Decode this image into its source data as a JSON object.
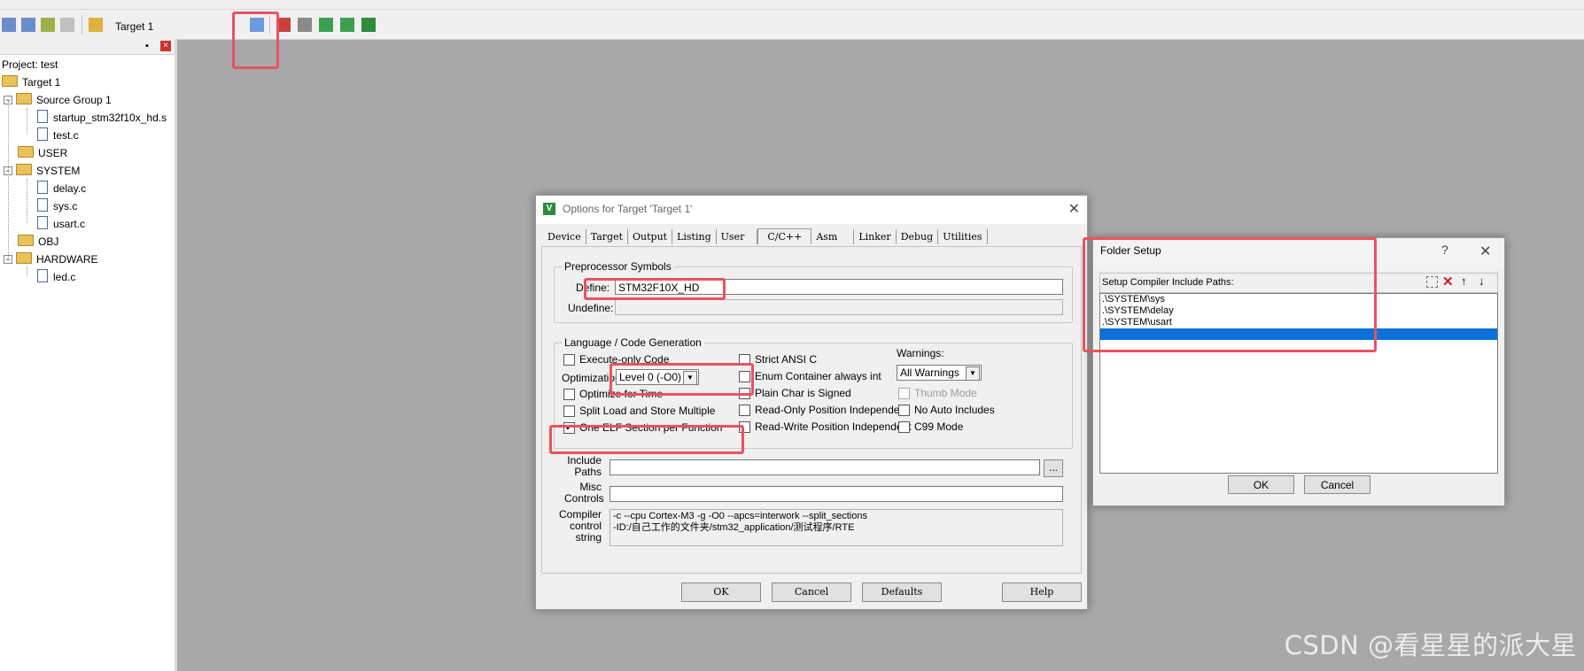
{
  "toolbar": {
    "target_name": "Target 1",
    "icons": [
      "new-file-icon",
      "open-icon",
      "save-icon",
      "cut-icon",
      "copy-icon",
      "paste-icon",
      "undo-icon",
      "redo-icon",
      "bookmark-icon",
      "find-icon",
      "debug-icon",
      "options-for-target-icon",
      "manage-components-icon",
      "download-icon",
      "build-icon",
      "rebuild-icon",
      "batch-build-icon"
    ]
  },
  "project": {
    "title": "Project: test",
    "target": "Target 1",
    "groups": [
      {
        "name": "Source Group 1",
        "files": [
          "startup_stm32f10x_hd.s",
          "test.c"
        ]
      },
      {
        "name": "USER",
        "files": []
      },
      {
        "name": "SYSTEM",
        "files": [
          "delay.c",
          "sys.c",
          "usart.c"
        ]
      },
      {
        "name": "OBJ",
        "files": []
      },
      {
        "name": "HARDWARE",
        "files": [
          "led.c"
        ]
      }
    ]
  },
  "options_dialog": {
    "title": "Options for Target 'Target 1'",
    "tabs": [
      "Device",
      "Target",
      "Output",
      "Listing",
      "User",
      "C/C++",
      "Asm",
      "Linker",
      "Debug",
      "Utilities"
    ],
    "active_tab": "C/C++",
    "preprocessor": {
      "group_label": "Preprocessor Symbols",
      "define_label": "Define:",
      "define_value": "STM32F10X_HD",
      "undefine_label": "Undefine:",
      "undefine_value": ""
    },
    "language": {
      "group_label": "Language / Code Generation",
      "execute_only": {
        "label": "Execute-only Code",
        "checked": false
      },
      "optimization_label": "Optimization:",
      "optimization_value": "Level 0 (-O0)",
      "optimize_time": {
        "label": "Optimize for Time",
        "checked": false
      },
      "split_load": {
        "label": "Split Load and Store Multiple",
        "checked": false
      },
      "one_elf": {
        "label": "One ELF Section per Function",
        "checked": true
      },
      "strict_ansi": {
        "label": "Strict ANSI C",
        "checked": false
      },
      "enum_container": {
        "label": "Enum Container always int",
        "checked": false
      },
      "plain_char": {
        "label": "Plain Char is Signed",
        "checked": false
      },
      "ro_position": {
        "label": "Read-Only Position Independent",
        "checked": false
      },
      "rw_position": {
        "label": "Read-Write Position Independent",
        "checked": false
      },
      "warnings_label": "Warnings:",
      "warnings_value": "All Warnings",
      "thumb_mode": {
        "label": "Thumb Mode",
        "checked": false,
        "disabled": true
      },
      "no_auto_includes": {
        "label": "No Auto Includes",
        "checked": false
      },
      "c99_mode": {
        "label": "C99 Mode",
        "checked": false
      }
    },
    "include_paths_label": "Include\nPaths",
    "include_paths_value": "",
    "browse_label": "...",
    "misc_controls_label": "Misc\nControls",
    "misc_controls_value": "",
    "compiler_control_label": "Compiler\ncontrol\nstring",
    "compiler_control_lines": [
      "-c --cpu Cortex-M3 -g -O0 --apcs=interwork --split_sections",
      "-ID:/自己工作的文件夹/stm32_application/测试程序/RTE"
    ],
    "buttons": {
      "ok": "OK",
      "cancel": "Cancel",
      "defaults": "Defaults",
      "help": "Help"
    }
  },
  "folder_setup": {
    "title": "Folder Setup",
    "help_glyph": "?",
    "close_glyph": "✕",
    "header_label": "Setup Compiler Include Paths:",
    "paths": [
      ".\\SYSTEM\\sys",
      ".\\SYSTEM\\delay",
      ".\\SYSTEM\\usart",
      ""
    ],
    "selected_index": 3,
    "buttons": {
      "ok": "OK",
      "cancel": "Cancel"
    }
  },
  "watermark": "CSDN @看星星的派大星",
  "colors": {
    "highlight": "#e8535f",
    "selection": "#0b70d8",
    "workspace": "#a8a8a8"
  }
}
